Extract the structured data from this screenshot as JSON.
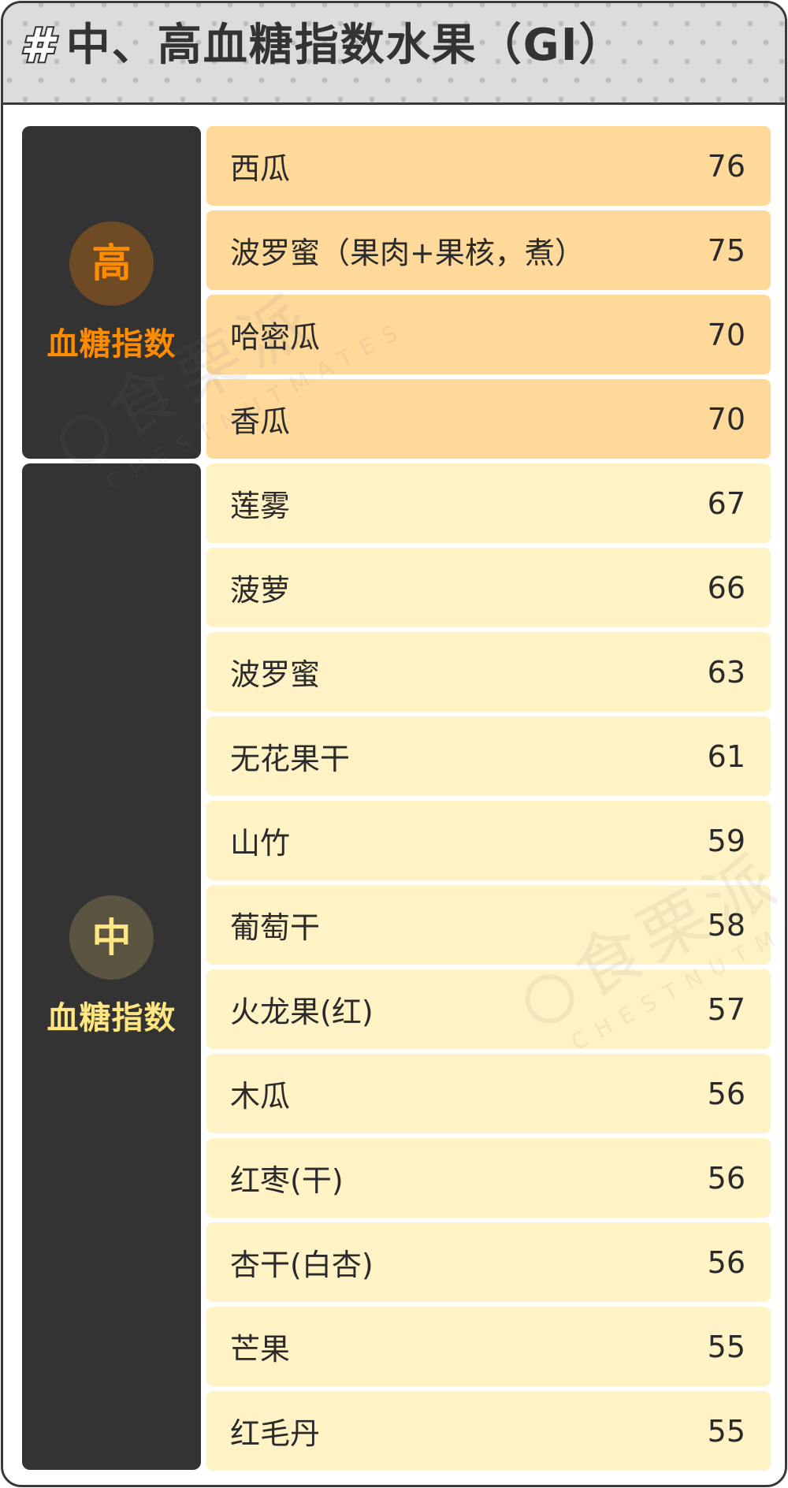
{
  "header": {
    "icon": "hash-icon",
    "hash_glyph": "#",
    "title": "中、高血糖指数水果（GI）"
  },
  "colors": {
    "high_row": "#ffd999",
    "mid_row": "#fff2c4",
    "panel": "#333333",
    "high_accent": "#ff8c00",
    "high_badge_bg": "#6e4a25",
    "mid_accent": "#ffe680",
    "mid_badge_bg": "#5a5440"
  },
  "tiers": [
    {
      "badge": "高",
      "label": "血糖指数",
      "items": [
        {
          "name": "西瓜",
          "gi": "76"
        },
        {
          "name": "波罗蜜（果肉+果核，煮）",
          "gi": "75"
        },
        {
          "name": "哈密瓜",
          "gi": "70"
        },
        {
          "name": "香瓜",
          "gi": "70"
        }
      ]
    },
    {
      "badge": "中",
      "label": "血糖指数",
      "items": [
        {
          "name": "莲雾",
          "gi": "67"
        },
        {
          "name": "菠萝",
          "gi": "66"
        },
        {
          "name": "波罗蜜",
          "gi": "63"
        },
        {
          "name": "无花果干",
          "gi": "61"
        },
        {
          "name": "山竹",
          "gi": "59"
        },
        {
          "name": "葡萄干",
          "gi": "58"
        },
        {
          "name": "火龙果(红)",
          "gi": "57"
        },
        {
          "name": "木瓜",
          "gi": "56"
        },
        {
          "name": "红枣(干)",
          "gi": "56"
        },
        {
          "name": "杏干(白杏)",
          "gi": "56"
        },
        {
          "name": "芒果",
          "gi": "55"
        },
        {
          "name": "红毛丹",
          "gi": "55"
        }
      ]
    }
  ],
  "watermark": {
    "logo": "食栗派",
    "sub": "CHESTNUTMATES"
  }
}
